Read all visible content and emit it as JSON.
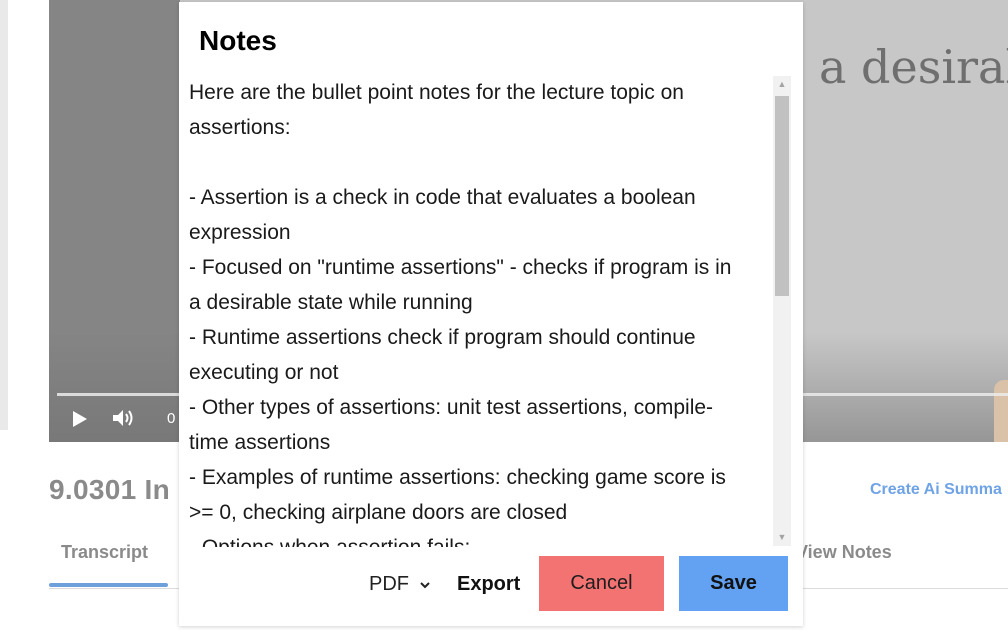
{
  "video": {
    "slide_text": "a desirable",
    "time_text": "0"
  },
  "lecture": {
    "title": "9.0301 In",
    "ai_summary_link": "Create Ai Summa"
  },
  "tabs": [
    {
      "label": "Transcript",
      "active": true
    },
    {
      "label": "View Notes",
      "active": false
    }
  ],
  "modal": {
    "title": "Notes",
    "lines": [
      "Here are the bullet point notes for the lecture topic on",
      "assertions:",
      "",
      "- Assertion is a check in code that evaluates a boolean",
      "expression",
      "- Focused on \"runtime assertions\" - checks if program is in",
      "a desirable state while running",
      "- Runtime assertions check if program should continue",
      "executing or not",
      "- Other types of assertions: unit test assertions, compile-",
      "time assertions",
      "- Examples of runtime assertions: checking game score is",
      ">= 0, checking airplane doors are closed",
      "- Options when assertion fails:"
    ],
    "format_select": "PDF",
    "export_label": "Export",
    "cancel_label": "Cancel",
    "save_label": "Save"
  },
  "colors": {
    "cancel": "#f37272",
    "save": "#63a1f2",
    "link": "#6fa3e6",
    "tab_underline": "#6ea0dc"
  }
}
